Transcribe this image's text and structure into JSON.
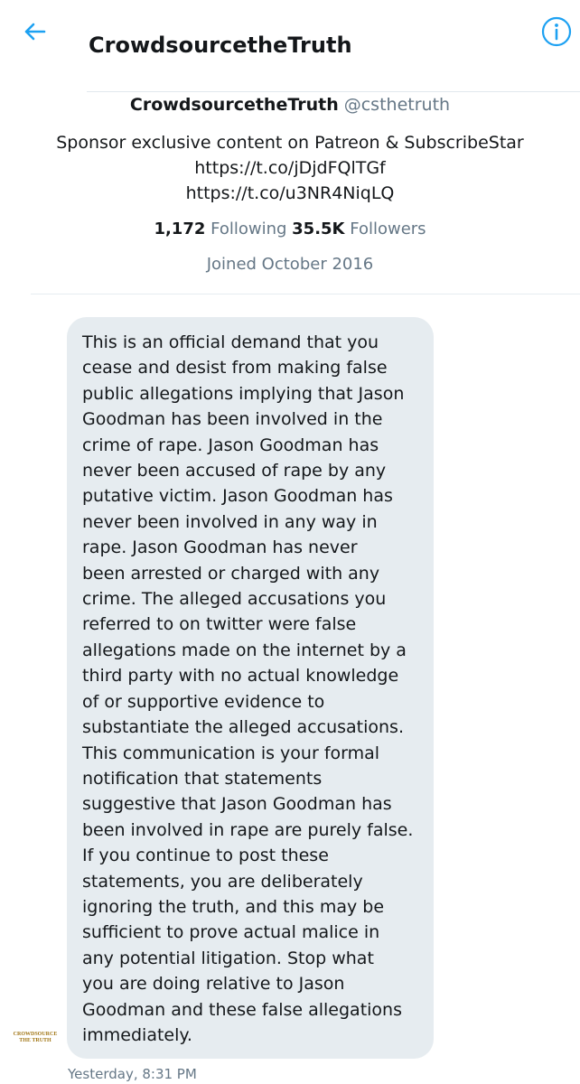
{
  "header": {
    "title": "CrowdsourcetheTruth",
    "back_icon": "arrow-left-icon",
    "info_icon": "info-circle-icon",
    "accent_color": "#1da1f2"
  },
  "profile": {
    "display_name": "CrowdsourcetheTruth",
    "handle": "@csthetruth",
    "bio": "Sponsor exclusive content on Patreon & SubscribeStar",
    "links": [
      "https://t.co/jDjdFQlTGf",
      "https://t.co/u3NR4NiqLQ"
    ],
    "following_count": "1,172",
    "following_label": "Following",
    "followers_count": "35.5K",
    "followers_label": "Followers",
    "joined": "Joined October 2016"
  },
  "message": {
    "text": "This is an official demand that you\ncease and desist from making false\npublic allegations implying that Jason\nGoodman has been involved in the\ncrime of rape.  Jason Goodman has\nnever been accused of rape by any\nputative victim.  Jason Goodman has\nnever been involved in any way in\nrape.  Jason Goodman has never\nbeen arrested or charged with any\ncrime. The alleged accusations you\nreferred to on twitter were false\nallegations made on the internet by a\nthird party with no actual knowledge\nof or supportive evidence to\nsubstantiate the alleged accusations.\nThis communication is your formal\nnotification that statements\nsuggestive that Jason Goodman has\nbeen involved in rape are purely false.\nIf you continue to post these\nstatements, you are deliberately\nignoring the truth, and this may be\nsufficient to prove actual malice in\nany potential litigation.  Stop what\nyou are doing relative to Jason\nGoodman and these false allegations\nimmediately.",
    "timestamp": "Yesterday, 8:31 PM",
    "avatar_text": [
      "CROWDSOURCE",
      "THE TRUTH"
    ]
  }
}
